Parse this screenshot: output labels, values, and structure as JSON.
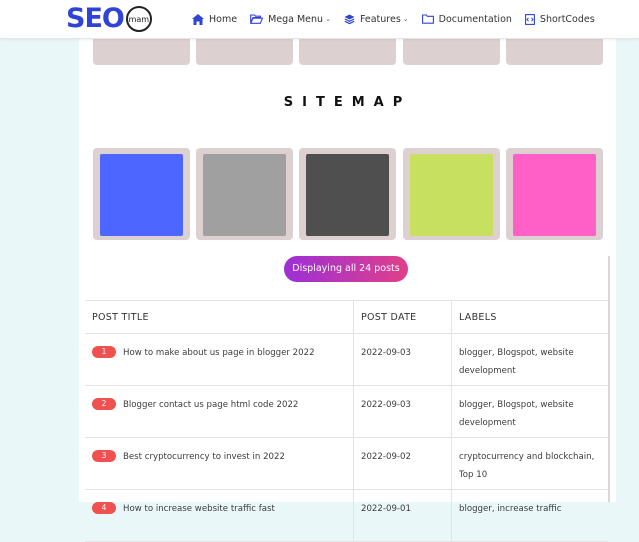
{
  "header": {
    "logo_text": "SEO",
    "logo_badge": "mam",
    "nav": [
      {
        "label": "Home",
        "icon": "home-icon"
      },
      {
        "label": "Mega Menu",
        "icon": "folder-open-icon",
        "dropdown": true
      },
      {
        "label": "Features",
        "icon": "layers-icon",
        "dropdown": true
      },
      {
        "label": "Documentation",
        "icon": "folder-icon"
      },
      {
        "label": "ShortCodes",
        "icon": "code-file-icon"
      }
    ],
    "chevron": "⌄"
  },
  "colors": {
    "top_row": [
      "#ff8c4a",
      "#38b8ff",
      "#8b4cf0",
      "#4466f0",
      "#ffbb55"
    ],
    "sitemap_row": [
      "#4d66ff",
      "#a0a0a0",
      "#4f4f4f",
      "#c8e060",
      "#ff60c8"
    ],
    "badge": "#f05050"
  },
  "sitemap": {
    "title": "SITEMAP",
    "count_label": "Displaying all 24 posts"
  },
  "table": {
    "headers": [
      "POST TITLE",
      "POST DATE",
      "LABELS"
    ],
    "rows": [
      {
        "num": "1",
        "title": "How to make about us page in blogger 2022",
        "date": "2022-09-03",
        "labels": "blogger, Blogspot, website development"
      },
      {
        "num": "2",
        "title": "Blogger contact us page html code 2022",
        "date": "2022-09-03",
        "labels": "blogger, Blogspot, website development"
      },
      {
        "num": "3",
        "title": "Best cryptocurrency to invest in 2022",
        "date": "2022-09-02",
        "labels": "cryptocurrency and blockchain, Top 10"
      },
      {
        "num": "4",
        "title": "How to increase website traffic fast",
        "date": "2022-09-01",
        "labels": "blogger, increase traffic"
      }
    ]
  }
}
